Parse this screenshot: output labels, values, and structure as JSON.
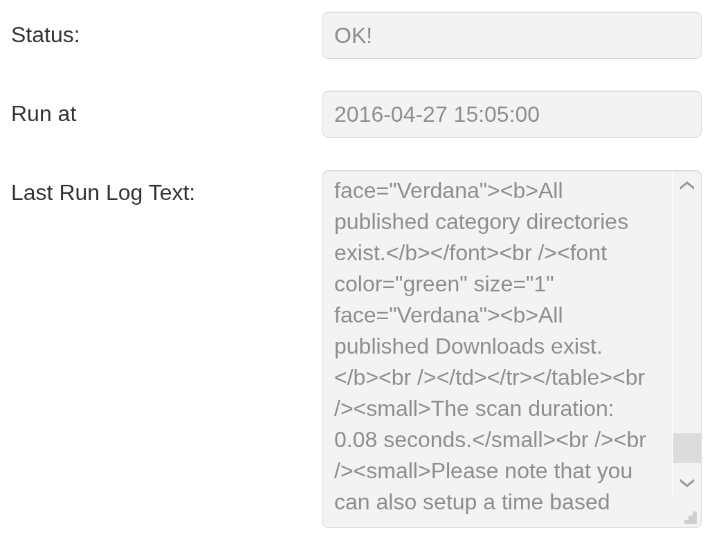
{
  "form": {
    "fields": [
      {
        "kind": "input",
        "label": "Status:",
        "value": "OK!",
        "disabled": true
      },
      {
        "kind": "input",
        "label": "Run at",
        "value": "2016-04-27 15:05:00",
        "disabled": true
      },
      {
        "kind": "textarea",
        "label": "Last Run Log Text:",
        "disabled": true,
        "lines": [
          "face=\"Verdana\"><b>All",
          "published category directories",
          "exist.</b></font><br /><font",
          "color=\"green\" size=\"1\"",
          "face=\"Verdana\"><b>All",
          "published Downloads exist.",
          "</b><br /></td></tr></table><br",
          "/><small>The scan duration:",
          "0.08 seconds.</small><br /><br",
          "/><small>Please note that you",
          "can also setup a time based"
        ]
      }
    ]
  }
}
